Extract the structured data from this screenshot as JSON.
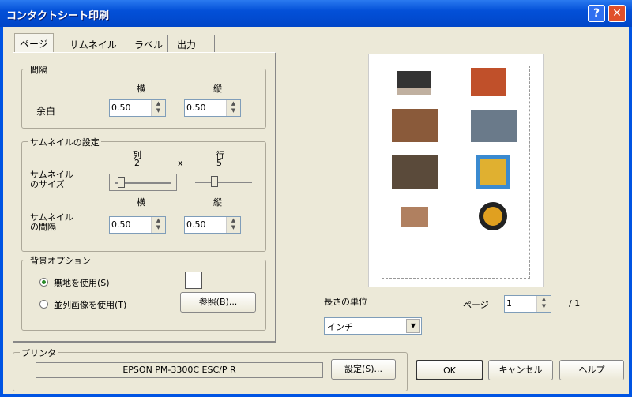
{
  "window": {
    "title": "コンタクトシート印刷",
    "help": "?",
    "close": "✕"
  },
  "tabs": [
    "ページ",
    "サムネイル",
    "ラベル",
    "出力"
  ],
  "spacing": {
    "title": "間隔",
    "col_h": "横",
    "col_v": "縦",
    "margin_label": "余白",
    "margin_h": "0.50",
    "margin_v": "0.50"
  },
  "thumb": {
    "title": "サムネイルの設定",
    "cols_label": "列",
    "cols": "2",
    "x": "x",
    "rows_label": "行",
    "rows": "5",
    "size_label1": "サムネイル",
    "size_label2": "のサイズ",
    "col_h": "横",
    "col_v": "縦",
    "gap_label1": "サムネイル",
    "gap_label2": "の間隔",
    "gap_h": "0.50",
    "gap_v": "0.50"
  },
  "bg": {
    "title": "背景オプション",
    "plain": "無地を使用(S)",
    "image": "並列画像を使用(T)",
    "browse": "参照(B)..."
  },
  "printer": {
    "title": "プリンタ",
    "name": "EPSON PM-3300C ESC/P R",
    "settings": "設定(S)..."
  },
  "units": {
    "label": "長さの単位",
    "value": "インチ"
  },
  "page": {
    "label": "ページ",
    "value": "1",
    "total": "/ 1"
  },
  "buttons": {
    "ok": "OK",
    "cancel": "キャンセル",
    "help": "ヘルプ"
  },
  "colors": {
    "title": "#0054e3",
    "face": "#ece9d8"
  }
}
